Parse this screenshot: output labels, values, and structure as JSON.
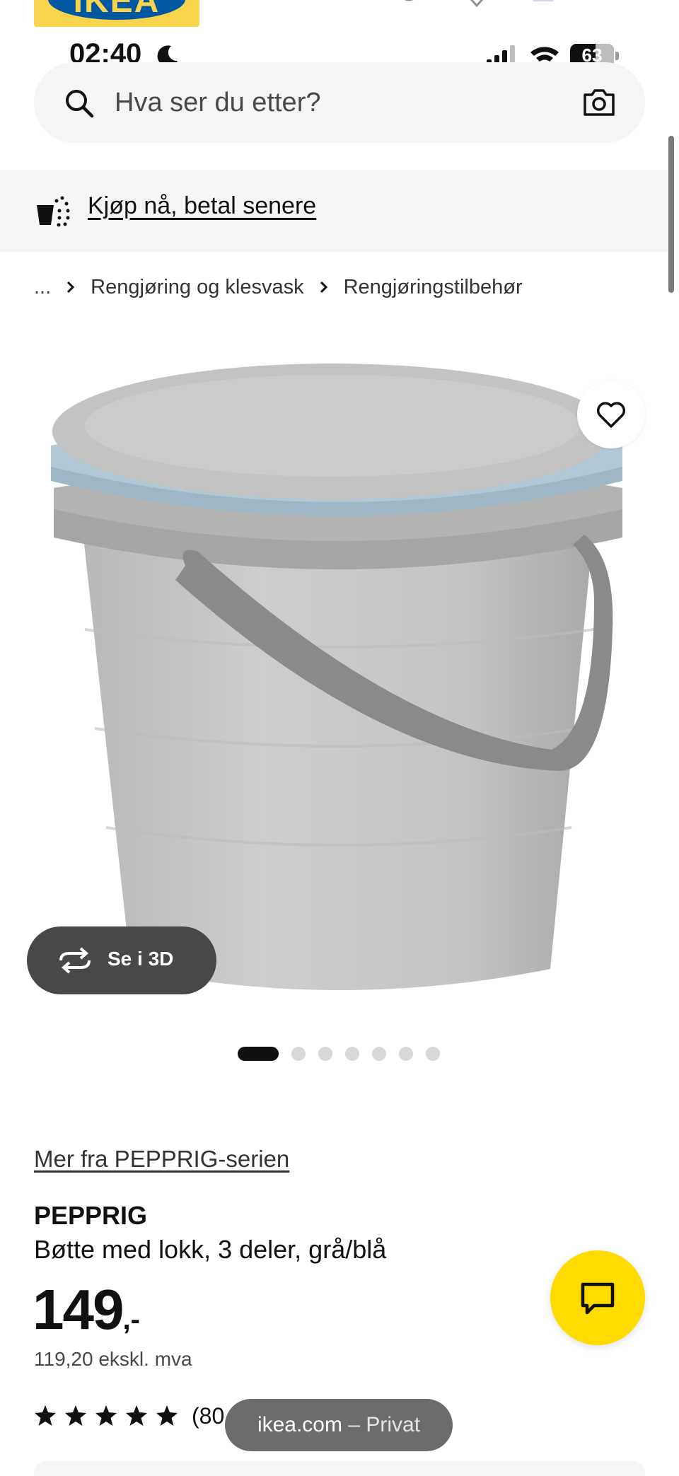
{
  "status_bar": {
    "time": "02:40",
    "battery": "63"
  },
  "header": {
    "logo_text": "IKEA"
  },
  "search": {
    "placeholder": "Hva ser du etter?"
  },
  "promo": {
    "link_text": "Kjøp nå, betal senere"
  },
  "breadcrumb": {
    "items": [
      {
        "label": "..."
      },
      {
        "label": "Rengjøring og klesvask"
      },
      {
        "label": "Rengjøringstilbehør"
      }
    ]
  },
  "gallery": {
    "view_3d_label": "Se i 3D",
    "dot_count": 7,
    "active_dot": 0
  },
  "product": {
    "series_link": "Mer fra PEPPRIG-serien",
    "name": "PEPPRIG",
    "description": "Bøtte med lokk, 3 deler, grå/blå",
    "price_integer": "149",
    "price_suffix": ",-",
    "price_ex_vat": "119,20 ekskl. mva",
    "rating_stars": 5,
    "rating_count": "(80"
  },
  "browser": {
    "domain": "ikea.com",
    "separator": "–",
    "mode": "Privat"
  },
  "colors": {
    "brand_yellow": "#ffdb00",
    "brand_blue": "#0058a3",
    "light_bg": "#f5f5f5",
    "dark_pill": "#484848"
  },
  "icons": [
    "search-icon",
    "camera-icon",
    "cart-icon",
    "heart-icon",
    "rotate-icon",
    "star-icon",
    "chat-icon",
    "moon-icon",
    "signal-icon",
    "wifi-icon",
    "battery-icon"
  ]
}
